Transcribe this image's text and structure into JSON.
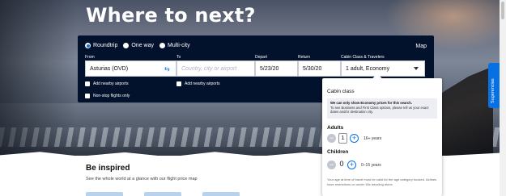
{
  "hero": {
    "title": "Where to next?"
  },
  "trip_types": [
    {
      "label": "Roundtrip",
      "selected": true
    },
    {
      "label": "One way",
      "selected": false
    },
    {
      "label": "Multi-city",
      "selected": false
    }
  ],
  "map_label": "Map",
  "fields": {
    "from": {
      "label": "From",
      "value": "Asturias (OVD)"
    },
    "to": {
      "label": "To",
      "placeholder": "Country, city or airport"
    },
    "depart": {
      "label": "Depart",
      "value": "5/23/20"
    },
    "return": {
      "label": "Return",
      "value": "5/30/20"
    },
    "cabin": {
      "label": "Cabin Class & Travelers",
      "value": "1 adult, Economy"
    }
  },
  "checkboxes": {
    "nearby_from": "Add nearby airports",
    "nearby_to": "Add nearby airports",
    "nonstop": "Non-stop flights only"
  },
  "cabin_popup": {
    "title": "Cabin class",
    "notice_bold": "We can only show Economy prices for this search.",
    "notice_text": "To see Business and First Class options, please tell us your exact dates and/or destination city.",
    "adults_label": "Adults",
    "adults_count": "1",
    "adults_age": "16+ years",
    "children_label": "Children",
    "children_count": "0",
    "children_age": "0–15 years",
    "age_note": "Your age at time of travel must be valid for the age category booked. Airlines have restrictions on under 18s traveling alone."
  },
  "side_tab": "Sugerencias",
  "inspired": {
    "title": "Be inspired",
    "subtitle": "See the whole world at a glance with our flight price map"
  },
  "colors": {
    "search_bg": "#02122c",
    "accent": "#0770e3"
  }
}
